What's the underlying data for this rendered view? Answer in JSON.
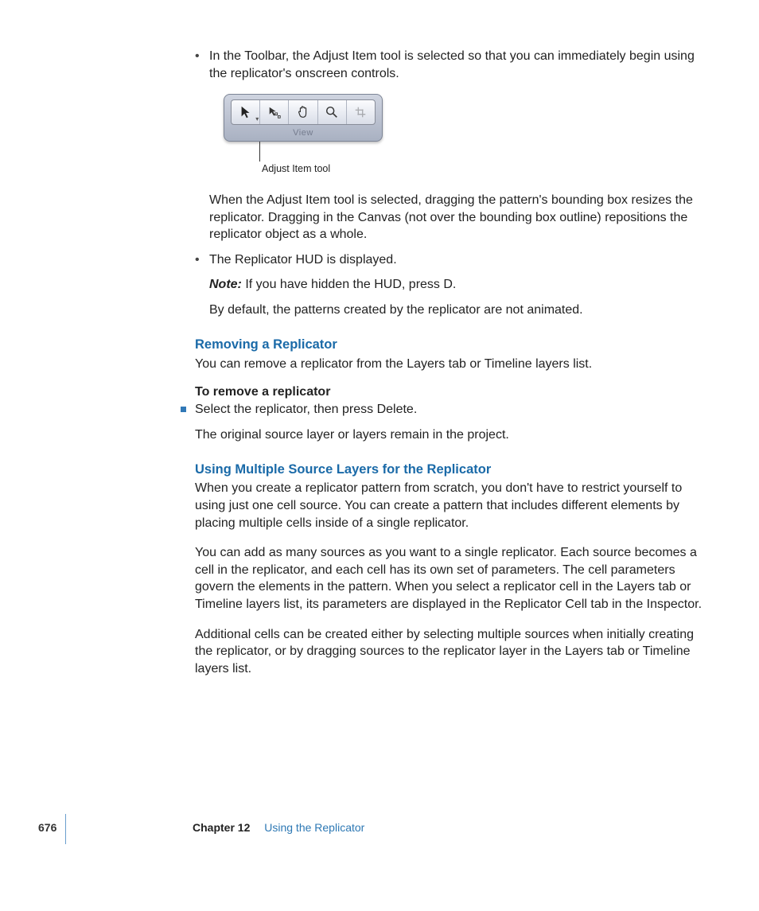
{
  "bullets": {
    "b1": "In the Toolbar, the Adjust Item tool is selected so that you can immediately begin using the replicator's onscreen controls.",
    "b1_after": "When the Adjust Item tool is selected, dragging the pattern's bounding box resizes the replicator. Dragging in the Canvas (not over the bounding box outline) repositions the replicator object as a whole.",
    "b2": "The Replicator HUD is displayed.",
    "b2_note_label": "Note:",
    "b2_note": "  If you have hidden the HUD, press D.",
    "b2_after": "By default, the patterns created by the replicator are not animated."
  },
  "toolbar": {
    "view_label": "View",
    "caption": "Adjust Item tool",
    "icons": [
      "arrow",
      "adjust",
      "hand",
      "zoom",
      "crop"
    ]
  },
  "removing": {
    "heading": "Removing a Replicator",
    "intro": "You can remove a replicator from the Layers tab or Timeline layers list.",
    "howto_label": "To remove a replicator",
    "step": "Select the replicator, then press Delete.",
    "after": "The original source layer or layers remain in the project."
  },
  "multi": {
    "heading": "Using Multiple Source Layers for the Replicator",
    "p1": "When you create a replicator pattern from scratch, you don't have to restrict yourself to using just one cell source. You can create a pattern that includes different elements by placing multiple cells inside of a single replicator.",
    "p2": "You can add as many sources as you want to a single replicator. Each source becomes a cell in the replicator, and each cell has its own set of parameters. The cell parameters govern the elements in the pattern. When you select a replicator cell in the Layers tab or Timeline layers list, its parameters are displayed in the Replicator Cell tab in the Inspector.",
    "p3": "Additional cells can be created either by selecting multiple sources when initially creating the replicator, or by dragging sources to the replicator layer in the Layers tab or Timeline layers list."
  },
  "footer": {
    "page": "676",
    "chapter_label": "Chapter 12",
    "chapter_title": "Using the Replicator"
  }
}
